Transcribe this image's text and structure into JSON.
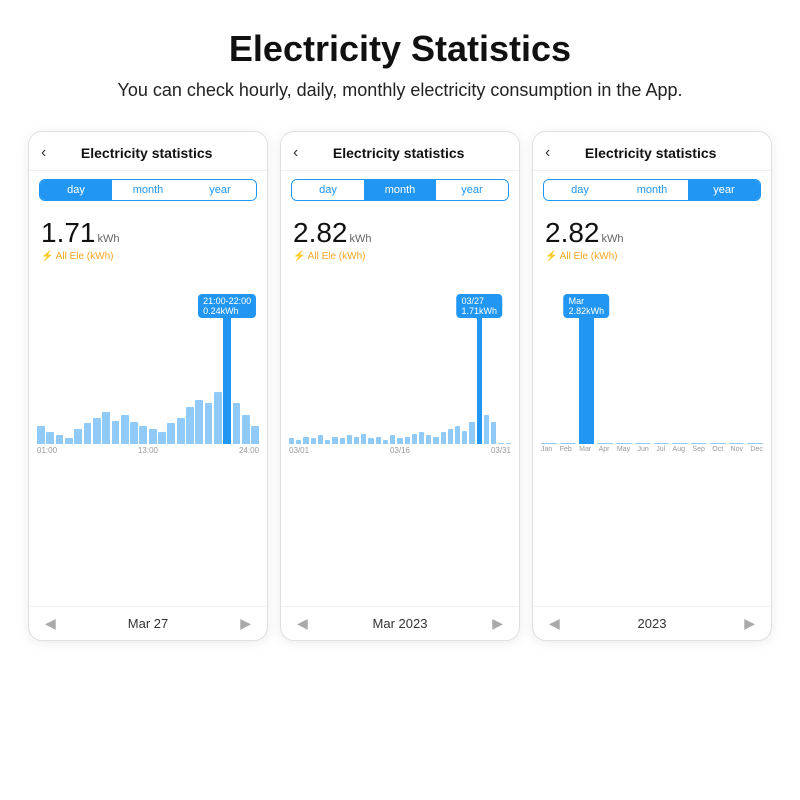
{
  "page": {
    "title": "Electricity Statistics",
    "subtitle": "You can check hourly, daily, monthly electricity consumption in the App."
  },
  "phones": [
    {
      "id": "day-phone",
      "header_title": "Electricity statistics",
      "tabs": [
        "day",
        "month",
        "year"
      ],
      "active_tab": 0,
      "kwh_value": "1.71",
      "kwh_unit": "kWh",
      "kwh_label": "⚡ All Ele (kWh)",
      "tooltip": "21:00-22:00\n0.24kWh",
      "x_labels": [
        "01:00",
        "13:00",
        "24:00"
      ],
      "nav_label": "Mar 27",
      "chart_type": "day"
    },
    {
      "id": "month-phone",
      "header_title": "Electricity statistics",
      "tabs": [
        "day",
        "month",
        "year"
      ],
      "active_tab": 1,
      "kwh_value": "2.82",
      "kwh_unit": "kWh",
      "kwh_label": "⚡ All Ele (kWh)",
      "tooltip": "03/27\n1.71kWh",
      "x_labels": [
        "03/01",
        "03/16",
        "03/31"
      ],
      "nav_label": "Mar 2023",
      "chart_type": "month"
    },
    {
      "id": "year-phone",
      "header_title": "Electricity statistics",
      "tabs": [
        "day",
        "month",
        "year"
      ],
      "active_tab": 2,
      "kwh_value": "2.82",
      "kwh_unit": "kWh",
      "kwh_label": "⚡ All Ele (kWh)",
      "tooltip": "Mar\n2.82kWh",
      "x_labels": [
        "Jan",
        "Feb",
        "Mar",
        "Apr",
        "May",
        "Jun",
        "Jul",
        "Aug",
        "Sep",
        "Oct",
        "Nov",
        "Dec"
      ],
      "nav_label": "2023",
      "chart_type": "year"
    }
  ]
}
